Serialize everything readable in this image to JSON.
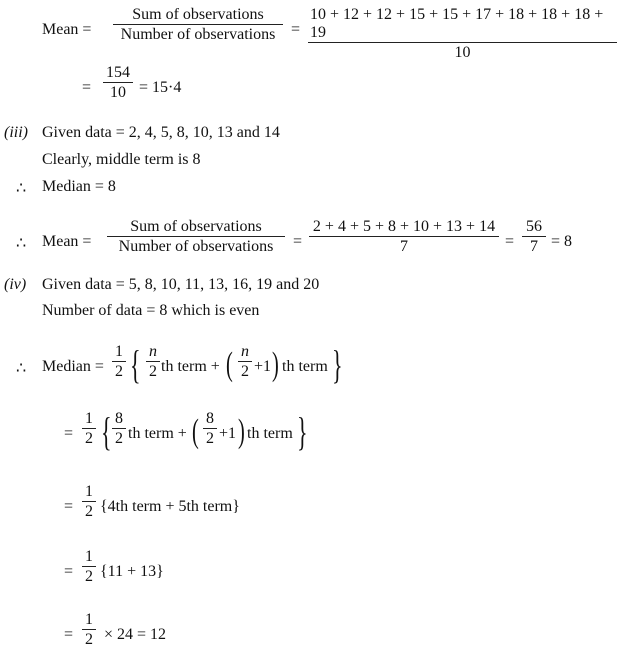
{
  "block1": {
    "mean_label": "Mean =",
    "sum_obs": "Sum of observations",
    "num_obs": "Number of observations",
    "eq": "=",
    "sum_expr": "10 + 12 + 12 + 15 + 15 + 17 + 18 + 18 + 18 + 19",
    "count": "10",
    "frac_num": "154",
    "frac_den": "10",
    "result": "= 15·4"
  },
  "part3": {
    "label": "(iii)",
    "given": "Given data = 2, 4, 5, 8, 10, 13 and 14",
    "middle": "Clearly, middle term is 8",
    "therefore": "∴",
    "median": "Median = 8",
    "mean_label": "Mean =",
    "sum_obs": "Sum of observations",
    "num_obs": "Number of observations",
    "eq": "=",
    "sum_expr": "2 + 4 + 5 + 8 + 10 + 13 + 14",
    "count": "7",
    "frac_num": "56",
    "frac_den": "7",
    "result": "= 8"
  },
  "part4": {
    "label": "(iv)",
    "given": "Given data = 5, 8, 10, 11, 13, 16, 19 and 20",
    "count_text": "Number of data = 8 which is even",
    "therefore": "∴",
    "median_label": "Median =",
    "half_num": "1",
    "half_den": "2",
    "n": "n",
    "two": "2",
    "eight": "8",
    "th_term_plus": "th term +",
    "plus_one": "+1",
    "th_term": "th term",
    "step3": "{4th term + 5th term}",
    "step4": "{11 + 13}",
    "step5": "× 24 = 12",
    "eq": "="
  }
}
